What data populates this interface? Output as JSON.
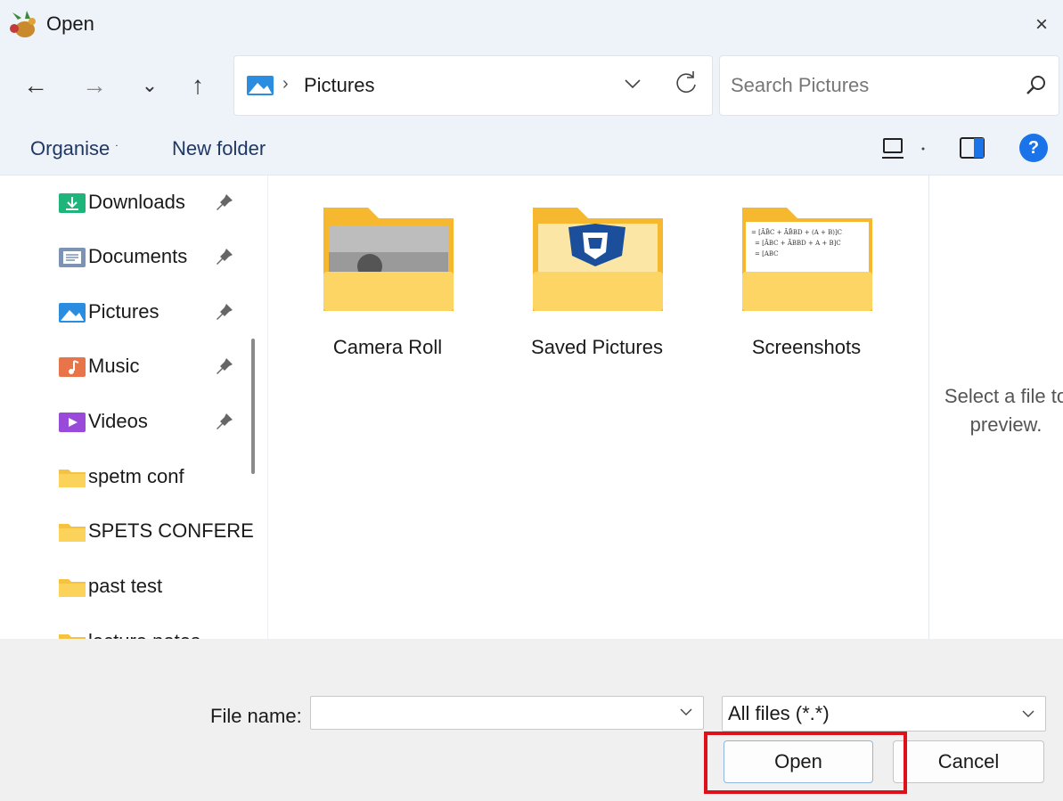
{
  "window": {
    "title": "Open",
    "close_label": "×"
  },
  "nav": {
    "back": "←",
    "forward": "→",
    "recent": "⌄",
    "up": "↑",
    "separator": "›",
    "address": "Pictures",
    "search_placeholder": "Search Pictures"
  },
  "toolbar": {
    "organise": "Organise",
    "organise_caret": "˙",
    "new_folder": "New folder",
    "help": "?"
  },
  "sidebar": {
    "items": [
      {
        "label": "Downloads",
        "icon": "downloads-icon",
        "pinned": true
      },
      {
        "label": "Documents",
        "icon": "documents-icon",
        "pinned": true
      },
      {
        "label": "Pictures",
        "icon": "pictures-icon",
        "pinned": true
      },
      {
        "label": "Music",
        "icon": "music-icon",
        "pinned": true
      },
      {
        "label": "Videos",
        "icon": "videos-icon",
        "pinned": true
      },
      {
        "label": "spetm conf",
        "icon": "folder-icon",
        "pinned": false
      },
      {
        "label": "SPETS CONFERENCE",
        "icon": "folder-icon",
        "pinned": false
      },
      {
        "label": "past test",
        "icon": "folder-icon",
        "pinned": false
      },
      {
        "label": "lecture notes",
        "icon": "folder-icon",
        "pinned": false
      }
    ]
  },
  "content": {
    "folders": [
      {
        "label": "Camera Roll"
      },
      {
        "label": "Saved Pictures"
      },
      {
        "label": "Screenshots"
      }
    ],
    "screenshot_thumb_lines": [
      "= [ĀB̄C + ĀB̄BD + (A + B)]C",
      "= [ĀBC + ĀBBD + A + B]C",
      "= [ABC"
    ]
  },
  "preview": {
    "line1": "Select a file to",
    "line2": "preview."
  },
  "footer": {
    "file_name_label": "File name:",
    "file_name_value": "",
    "filter": "All files (*.*)",
    "open": "Open",
    "cancel": "Cancel"
  },
  "colors": {
    "chrome_bg": "#eef2f9",
    "accent": "#1a73e8",
    "highlight": "#e0101a",
    "folder": "#f5c242"
  }
}
